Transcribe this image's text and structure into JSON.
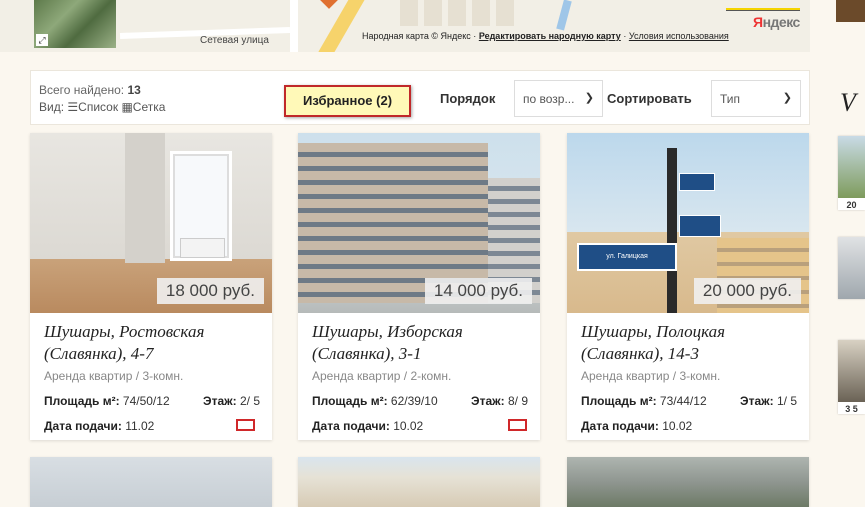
{
  "map": {
    "street_label": "Сетевая улица",
    "logo": "Яндекс",
    "credits_prefix": "Народная карта © Яндекс ·",
    "credits_edit_link": "Редактировать народную карту",
    "credits_separator": "·",
    "credits_terms_link": "Условия использования"
  },
  "toolbar": {
    "found_label": "Всего найдено:",
    "found_count": "13",
    "view_label": "Вид:",
    "view_list": "Список",
    "view_grid": "Сетка",
    "favorites_button": "Избранное (2)",
    "order_label": "Порядок",
    "order_value": "по возр...",
    "sort_label": "Сортировать",
    "sort_value": "Тип"
  },
  "side": {
    "title": "V",
    "items": [
      "20",
      "",
      "3 5"
    ]
  },
  "listings": [
    {
      "price": "18 000 руб.",
      "title": "Шушары, Ростовская (Славянка), 4-7",
      "type": "Аренда квартир / 3-комн.",
      "area_label": "Площадь м²:",
      "area_value": "74/50/12",
      "floor_label": "Этаж:",
      "floor_value": "2/ 5",
      "date_label": "Дата подачи:",
      "date_value": "11.02",
      "favorited": true
    },
    {
      "price": "14 000 руб.",
      "title": "Шушары, Изборская (Славянка), 3-1",
      "type": "Аренда квартир / 2-комн.",
      "area_label": "Площадь м²:",
      "area_value": "62/39/10",
      "floor_label": "Этаж:",
      "floor_value": "8/ 9",
      "date_label": "Дата подачи:",
      "date_value": "10.02",
      "favorited": true
    },
    {
      "price": "20 000 руб.",
      "title": "Шушары, Полоцкая (Славянка), 14-3",
      "type": "Аренда квартир / 3-комн.",
      "area_label": "Площадь м²:",
      "area_value": "73/44/12",
      "floor_label": "Этаж:",
      "floor_value": "1/ 5",
      "date_label": "Дата подачи:",
      "date_value": "10.02",
      "favorited": false
    }
  ],
  "icons": {
    "list": "list-icon",
    "grid": "grid-icon",
    "chevron": "chevron-down-icon"
  }
}
